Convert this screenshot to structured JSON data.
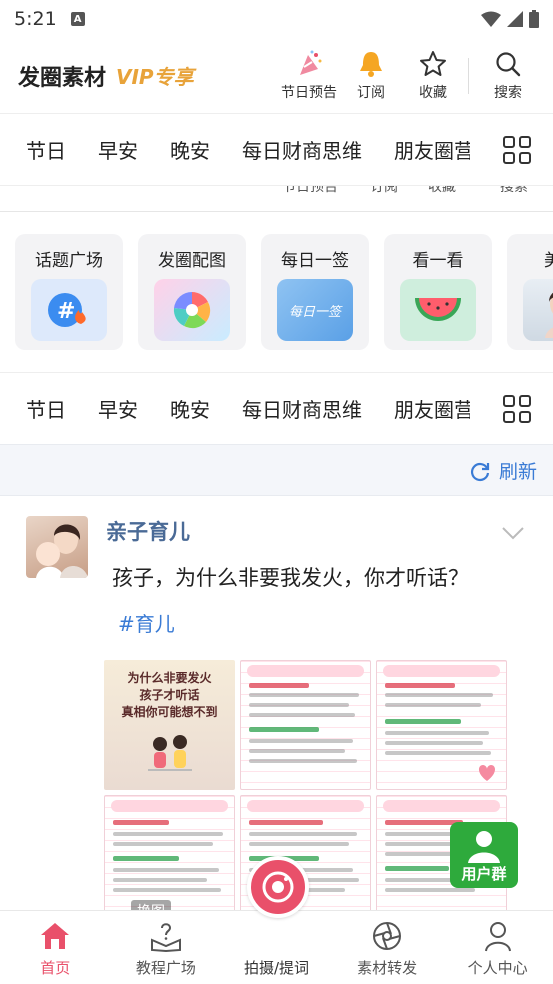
{
  "status_bar": {
    "time": "5:21",
    "notification_letter": "A"
  },
  "header": {
    "title": "发圈素材",
    "vip_label": "VIP专享",
    "actions": [
      {
        "label": "节日预告",
        "icon": "festival-icon"
      },
      {
        "label": "订阅",
        "icon": "bell-icon"
      },
      {
        "label": "收藏",
        "icon": "star-icon"
      },
      {
        "label": "搜索",
        "icon": "search-icon"
      }
    ]
  },
  "category_tabs": [
    "节日",
    "早安",
    "晚安",
    "每日财商思维",
    "朋友圈营"
  ],
  "ghost_labels": [
    "节日预告",
    "订阅",
    "收藏",
    "搜索"
  ],
  "feature_cards": [
    {
      "label": "话题广场",
      "icon": "hashtag-fire-icon"
    },
    {
      "label": "发圈配图",
      "icon": "aperture-icon"
    },
    {
      "label": "每日一签",
      "icon": "daily-sign-icon",
      "icon_text": "每日一签"
    },
    {
      "label": "看一看",
      "icon": "watermelon-icon"
    },
    {
      "label": "美业",
      "icon": "beauty-portrait-icon"
    }
  ],
  "refresh": {
    "label": "刷新"
  },
  "post": {
    "author": "亲子育儿",
    "text": "孩子，为什么非要我发火，你才听话？",
    "tag": "#育儿",
    "image_cover_text": "为什么非要发火\n孩子才听话\n真相你可能想不到",
    "overlay_label": "换图"
  },
  "floating": {
    "user_group_label": "用户群"
  },
  "bottom_nav": [
    {
      "label": "首页",
      "icon": "home-icon",
      "active": true
    },
    {
      "label": "教程广场",
      "icon": "tutorial-icon",
      "active": false
    },
    {
      "label": "拍摄/提词",
      "icon": "camera-icon",
      "active": false
    },
    {
      "label": "素材转发",
      "icon": "aperture-icon",
      "active": false
    },
    {
      "label": "个人中心",
      "icon": "user-icon",
      "active": false
    }
  ],
  "colors": {
    "accent": "#e9506a",
    "link": "#3a7bd5",
    "vip": "#e8a33a",
    "group_green": "#2eaa3c"
  }
}
